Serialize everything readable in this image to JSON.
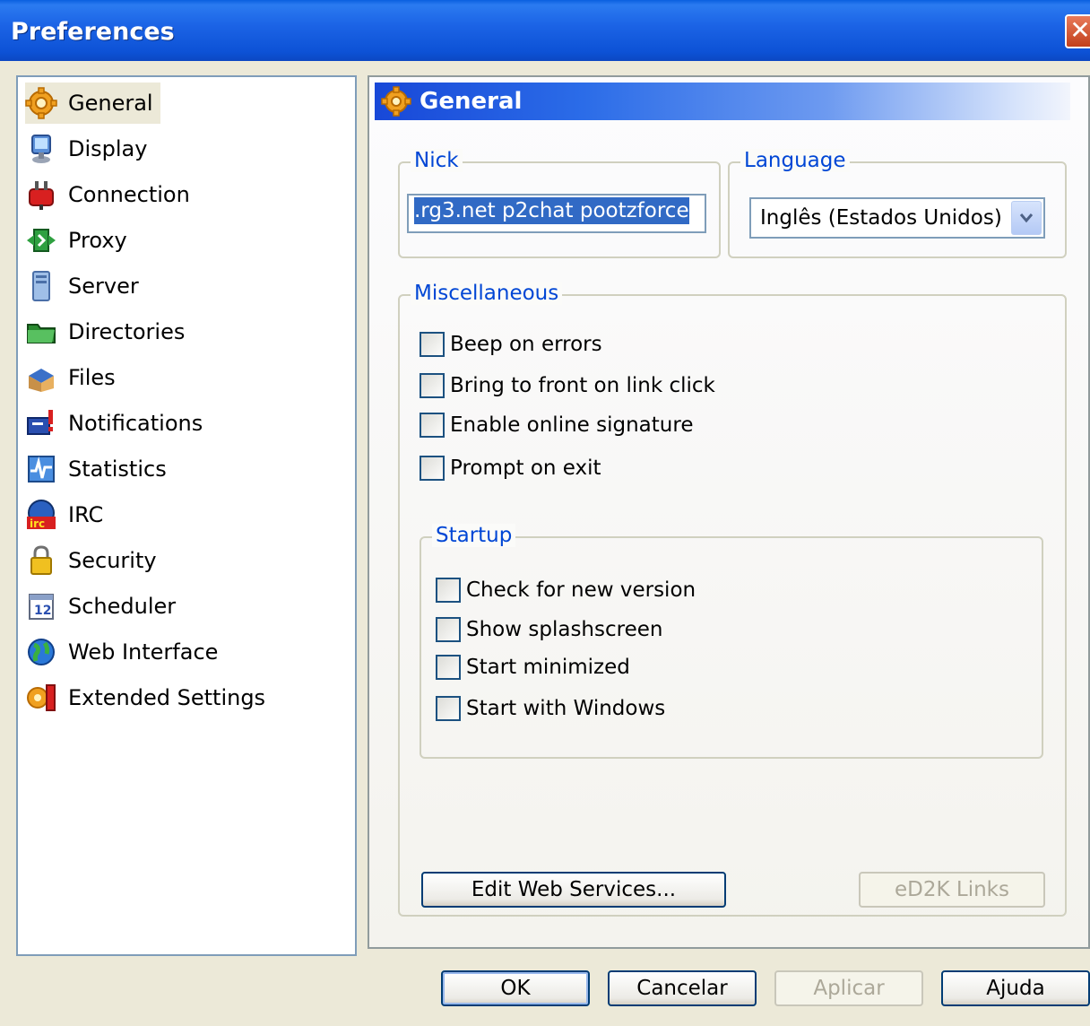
{
  "window": {
    "title": "Preferences",
    "close_icon": "close-icon"
  },
  "sidebar": {
    "items": [
      {
        "label": "General",
        "icon": "gear-icon",
        "selected": true
      },
      {
        "label": "Display",
        "icon": "monitor-icon"
      },
      {
        "label": "Connection",
        "icon": "plug-icon"
      },
      {
        "label": "Proxy",
        "icon": "proxy-icon"
      },
      {
        "label": "Server",
        "icon": "server-icon"
      },
      {
        "label": "Directories",
        "icon": "folder-icon"
      },
      {
        "label": "Files",
        "icon": "files-icon"
      },
      {
        "label": "Notifications",
        "icon": "notification-icon"
      },
      {
        "label": "Statistics",
        "icon": "statistics-icon"
      },
      {
        "label": "IRC",
        "icon": "irc-icon"
      },
      {
        "label": "Security",
        "icon": "lock-icon"
      },
      {
        "label": "Scheduler",
        "icon": "calendar-icon"
      },
      {
        "label": "Web Interface",
        "icon": "globe-icon"
      },
      {
        "label": "Extended Settings",
        "icon": "extended-settings-icon"
      }
    ]
  },
  "panel": {
    "title": "General",
    "nick": {
      "label": "Nick",
      "value": ".rg3.net p2chat pootzforce"
    },
    "language": {
      "label": "Language",
      "value": "Inglês (Estados Unidos)"
    },
    "misc": {
      "label": "Miscellaneous",
      "options": [
        {
          "label": "Beep on errors",
          "checked": false
        },
        {
          "label": "Bring to front on link click",
          "checked": false
        },
        {
          "label": "Enable online signature",
          "checked": false
        },
        {
          "label": "Prompt on exit",
          "checked": false
        }
      ]
    },
    "startup": {
      "label": "Startup",
      "options": [
        {
          "label": "Check for new version",
          "checked": false
        },
        {
          "label": "Show splashscreen",
          "checked": false
        },
        {
          "label": "Start minimized",
          "checked": false
        },
        {
          "label": "Start with Windows",
          "checked": false
        }
      ]
    },
    "edit_web_services": "Edit Web Services...",
    "ed2k_links": "eD2K Links"
  },
  "buttons": {
    "ok": "OK",
    "cancel": "Cancelar",
    "apply": "Aplicar",
    "help": "Ajuda"
  },
  "colors": {
    "titlebar": "#0a5fe0",
    "group_label": "#0046d5",
    "selection": "#316ac5"
  }
}
